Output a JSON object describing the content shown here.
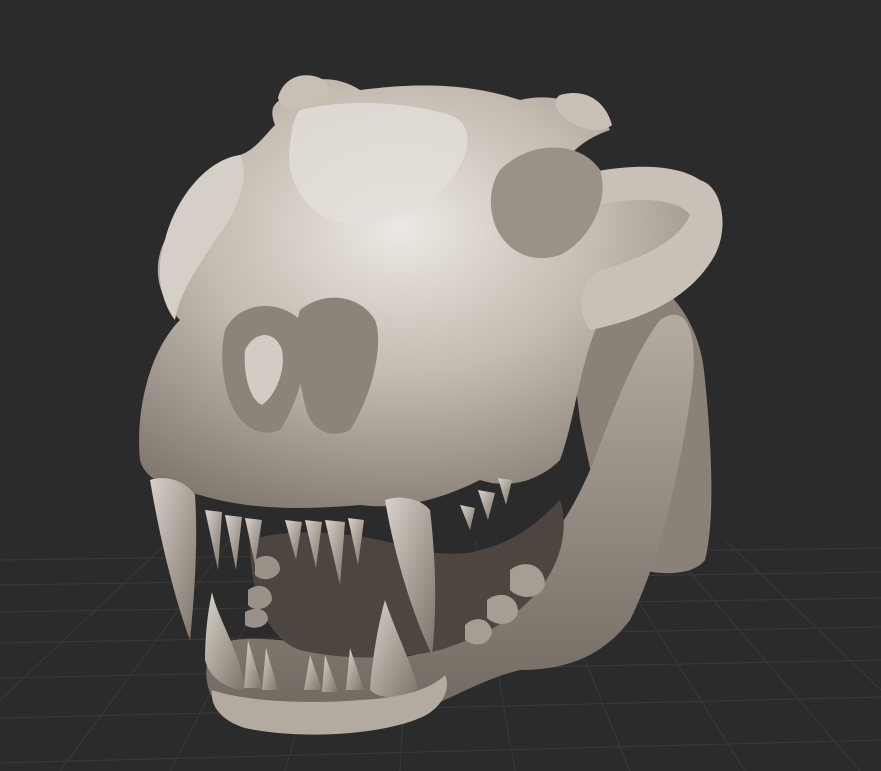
{
  "viewport": {
    "subject": "skull-model",
    "background_color": "#2b2b2b",
    "grid_color": "#3a3a3a",
    "model_color": "#b9b0a6",
    "model_shadow_color": "#7d746b",
    "model_highlight_color": "#e6e2dd",
    "axis_color": "#1fb01f",
    "grid_visible": true
  }
}
